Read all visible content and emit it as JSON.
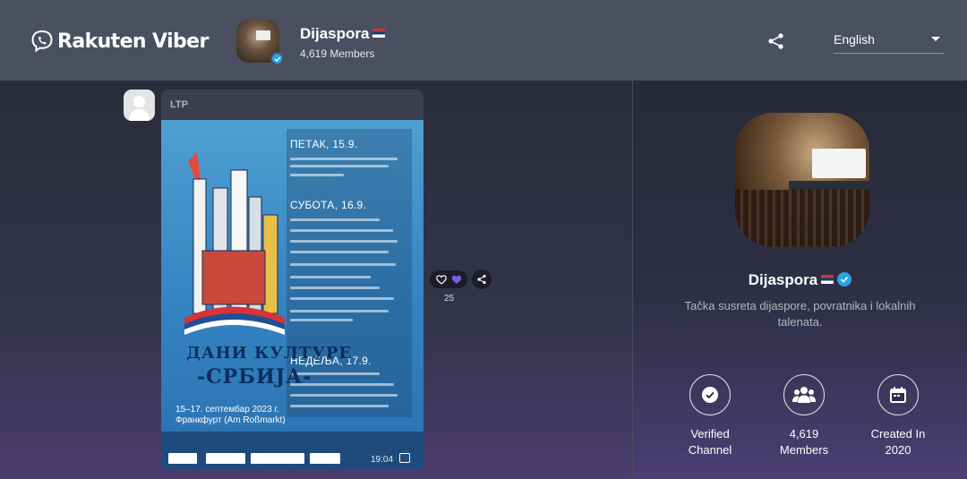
{
  "header": {
    "brand": "Rakuten Viber",
    "channel_name": "Dijaspora",
    "members": "4,619 Members",
    "language": "English"
  },
  "message": {
    "sender": "LTP",
    "time": "19:04",
    "reaction_count": "25",
    "poster": {
      "days": [
        "ПЕТАК, 15.9.",
        "СУБОТА, 16.9.",
        "НЕДЕЉА, 17.9."
      ],
      "title_line1": "ДАНИ КУЛТУРЕ",
      "title_line2": "-СРБИЈА-",
      "date_line": "15–17. септембар 2023 г.",
      "place_line": "Франкфурт (Am Roßmarkt)"
    }
  },
  "panel": {
    "name": "Dijaspora",
    "description": "Tačka susreta dijaspore, povratnika i lokalnih talenata.",
    "stats": [
      {
        "line1": "Verified",
        "line2": "Channel",
        "icon": "check-circle-icon"
      },
      {
        "line1": "4,619",
        "line2": "Members",
        "icon": "group-icon"
      },
      {
        "line1": "Created In",
        "line2": "2020",
        "icon": "calendar-icon"
      }
    ]
  },
  "colors": {
    "header_bg": "#4a5060",
    "verified_blue": "#29a3e6",
    "poster_blue": "#3585c2"
  }
}
